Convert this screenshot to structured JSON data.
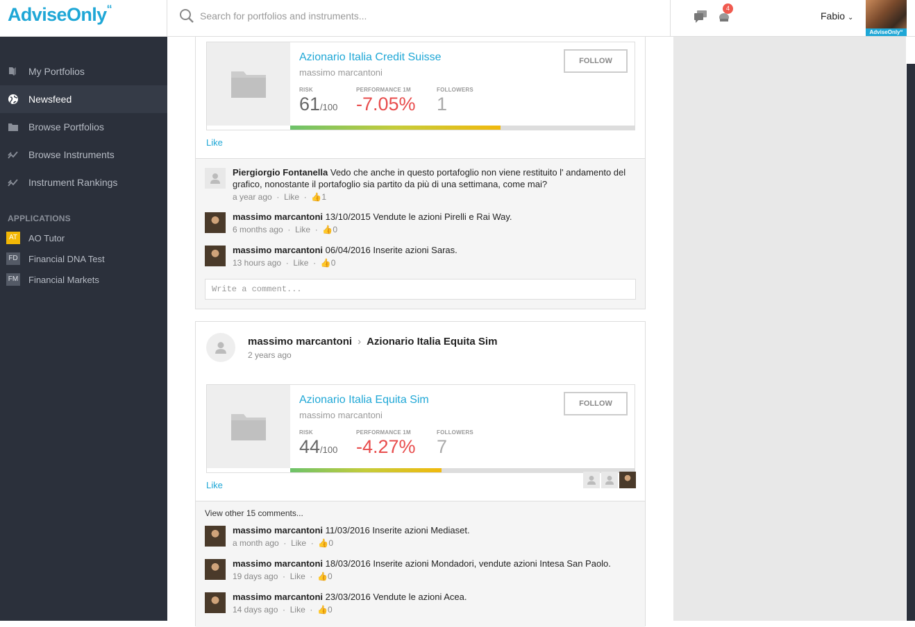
{
  "header": {
    "logo": "AdviseOnly",
    "logo_mark": "“",
    "search_placeholder": "Search for portfolios and instruments...",
    "notification_count": "4",
    "user_name": "Fabio",
    "avatar_tag": "AdviseOnly“"
  },
  "sidebar": {
    "items": [
      {
        "label": "My Portfolios",
        "icon": "book-icon"
      },
      {
        "label": "Newsfeed",
        "icon": "globe-icon"
      },
      {
        "label": "Browse Portfolios",
        "icon": "folder-icon"
      },
      {
        "label": "Browse Instruments",
        "icon": "trend-icon"
      },
      {
        "label": "Instrument Rankings",
        "icon": "trend-icon"
      }
    ],
    "apps_heading": "APPLICATIONS",
    "apps": [
      {
        "abbr": "AT",
        "label": "AO Tutor"
      },
      {
        "abbr": "FD",
        "label": "Financial DNA Test"
      },
      {
        "abbr": "FM",
        "label": "Financial Markets"
      }
    ]
  },
  "post1": {
    "portfolio": {
      "title": "Azionario Italia Credit Suisse",
      "owner": "massimo marcantoni",
      "follow": "FOLLOW",
      "risk_label": "RISK",
      "risk_value": "61",
      "risk_max": "/100",
      "perf_label": "PERFORMANCE 1M",
      "perf_value": "-7.05%",
      "followers_label": "FOLLOWERS",
      "followers_value": "1",
      "risk_fraction": 0.61
    },
    "like": "Like",
    "comments": [
      {
        "author": "Piergiorgio Fontanella",
        "text": "Vedo che anche in questo portafoglio non viene restituito l' andamento del grafico, nonostante il portafoglio sia partito da più di una settimana, come mai?",
        "time": "a year ago",
        "like": "Like",
        "likes": "1"
      },
      {
        "author": "massimo marcantoni",
        "text": "13/10/2015 Vendute le azioni Pirelli e Rai Way.",
        "time": "6 months ago",
        "like": "Like",
        "likes": "0"
      },
      {
        "author": "massimo marcantoni",
        "text": "06/04/2016 Inserite azioni Saras.",
        "time": "13 hours ago",
        "like": "Like",
        "likes": "0"
      }
    ],
    "write_placeholder": "Write a comment..."
  },
  "post2": {
    "author": "massimo marcantoni",
    "target": "Azionario Italia Equita Sim",
    "time": "2 years ago",
    "portfolio": {
      "title": "Azionario Italia Equita Sim",
      "owner": "massimo marcantoni",
      "follow": "FOLLOW",
      "risk_label": "RISK",
      "risk_value": "44",
      "risk_max": "/100",
      "perf_label": "PERFORMANCE 1M",
      "perf_value": "-4.27%",
      "followers_label": "FOLLOWERS",
      "followers_value": "7",
      "risk_fraction": 0.44
    },
    "like": "Like",
    "view_other": "View other 15 comments...",
    "comments": [
      {
        "author": "massimo marcantoni",
        "text": "11/03/2016 Inserite azioni Mediaset.",
        "time": "a month ago",
        "like": "Like",
        "likes": "0"
      },
      {
        "author": "massimo marcantoni",
        "text": "18/03/2016 Inserite azioni Mondadori, vendute azioni Intesa San Paolo.",
        "time": "19 days ago",
        "like": "Like",
        "likes": "0"
      },
      {
        "author": "massimo marcantoni",
        "text": "23/03/2016 Vendute le azioni Acea.",
        "time": "14 days ago",
        "like": "Like",
        "likes": "0"
      }
    ]
  }
}
